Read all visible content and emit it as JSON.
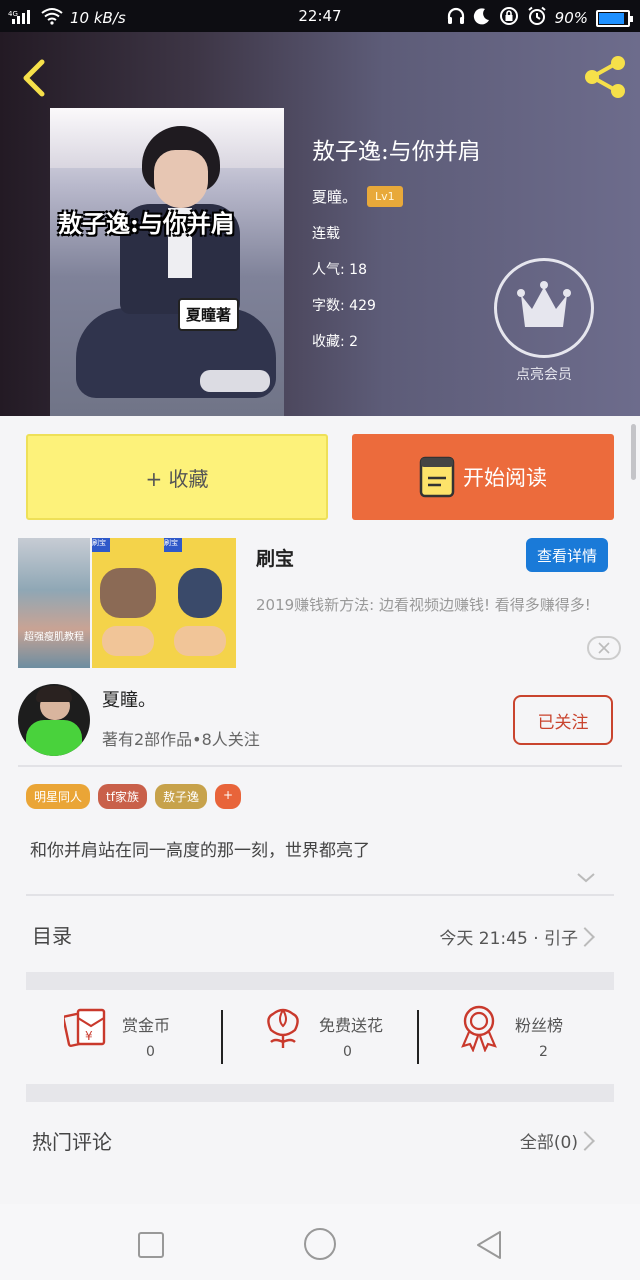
{
  "status_bar": {
    "network": "4G",
    "speed": "10 kB/s",
    "time": "22:47",
    "battery": "90%",
    "battery_level": 0.9
  },
  "book": {
    "cover_title": "敖子逸:与你并肩",
    "cover_author_tag": "夏瞳著",
    "title": "敖子逸:与你并肩",
    "author": "夏瞳。",
    "author_level": "Lv1",
    "status": "连载",
    "popularity": "人气: 18",
    "word_count": "字数: 429",
    "favorites": "收藏: 2",
    "vip_label": "点亮会员"
  },
  "actions": {
    "collect_label": "+ 收藏",
    "read_label": "开始阅读"
  },
  "ad": {
    "title": "刷宝",
    "button": "查看详情",
    "description": "2019赚钱新方法: 边看视频边赚钱! 看得多赚得多!",
    "thumb_caption": "超强瘦肌教程",
    "thumb_tag": "刷宝"
  },
  "author_card": {
    "name": "夏瞳。",
    "stats": "著有2部作品•8人关注",
    "follow_label": "已关注"
  },
  "tags": [
    {
      "label": "明星同人",
      "color": "#eaa536"
    },
    {
      "label": "tf家族",
      "color": "#c9604a"
    },
    {
      "label": "敖子逸",
      "color": "#c7a24b"
    },
    {
      "label": "+",
      "color": "#e8643a"
    }
  ],
  "synopsis": "和你并肩站在同一高度的那一刻，世界都亮了",
  "toc": {
    "label": "目录",
    "latest": "今天 21:45 · 引子"
  },
  "stats": [
    {
      "label": "赏金币",
      "value": "0",
      "icon": "red-envelope-icon"
    },
    {
      "label": "免费送花",
      "value": "0",
      "icon": "flower-icon"
    },
    {
      "label": "粉丝榜",
      "value": "2",
      "icon": "medal-icon"
    }
  ],
  "comments": {
    "label": "热门评论",
    "all_label": "全部(0)"
  },
  "colors": {
    "accent_orange": "#ec6b3c",
    "collect_yellow": "#fdf27a",
    "follow_red": "#c9442e",
    "ad_blue": "#1a7ad8"
  }
}
